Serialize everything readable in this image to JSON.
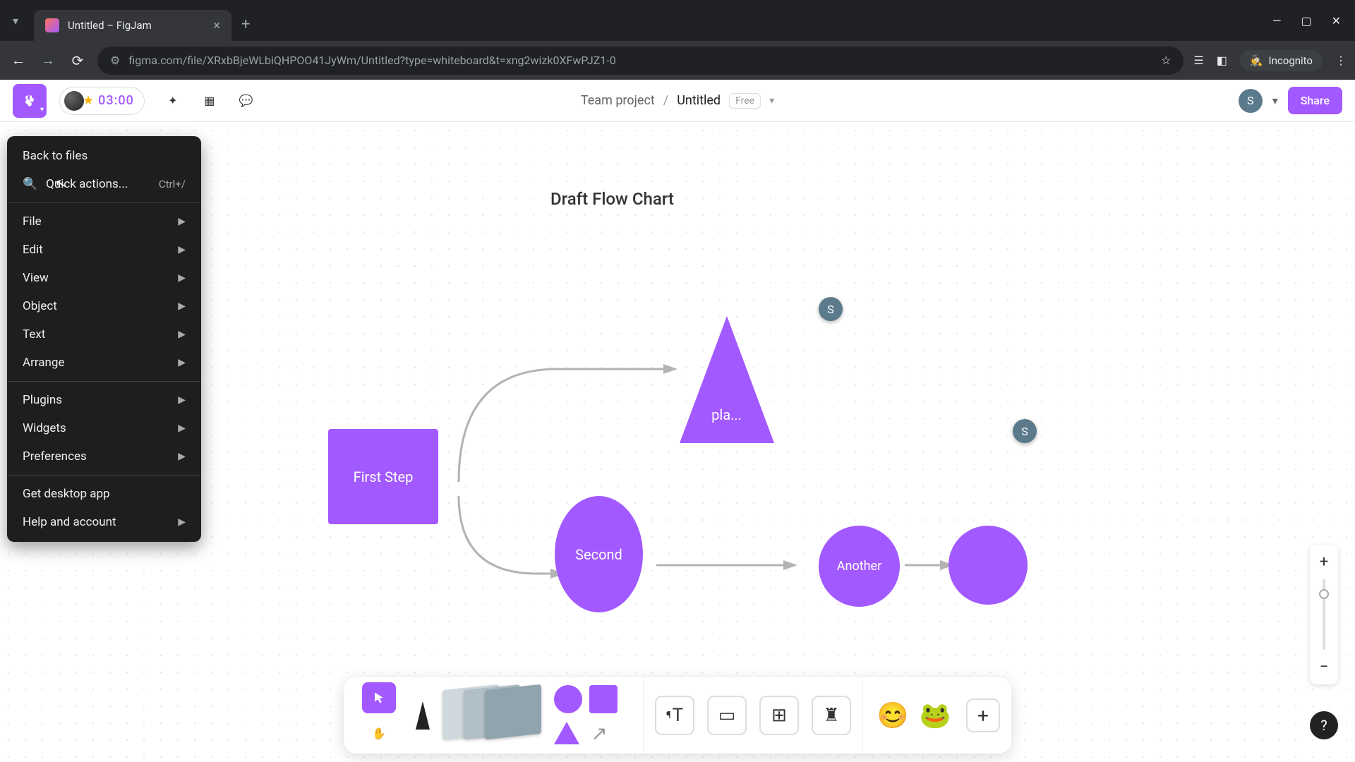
{
  "browser": {
    "tab_title": "Untitled – FigJam",
    "url": "figma.com/file/XRxbBjeWLbiQHPOO41JyWm/Untitled?type=whiteboard&t=xng2wizk0XFwPJZ1-0",
    "incognito_label": "Incognito"
  },
  "topbar": {
    "timer": "03:00",
    "project": "Team project",
    "filename": "Untitled",
    "plan_badge": "Free",
    "user_initial": "S",
    "share_label": "Share"
  },
  "menu": {
    "back_to_files": "Back to files",
    "quick_actions": "Quick actions...",
    "quick_actions_shortcut": "Ctrl+/",
    "file": "File",
    "edit": "Edit",
    "view": "View",
    "object": "Object",
    "text": "Text",
    "arrange": "Arrange",
    "plugins": "Plugins",
    "widgets": "Widgets",
    "preferences": "Preferences",
    "desktop_app": "Get desktop app",
    "help": "Help and account"
  },
  "canvas": {
    "title": "Draft Flow Chart",
    "shapes": {
      "rect_label": "First Step",
      "triangle_label": "pla...",
      "ellipse_label": "Second",
      "circle2_label": "Another"
    },
    "presence_initial": "S"
  },
  "toolbar": {
    "text_tool": "T"
  },
  "help": "?"
}
